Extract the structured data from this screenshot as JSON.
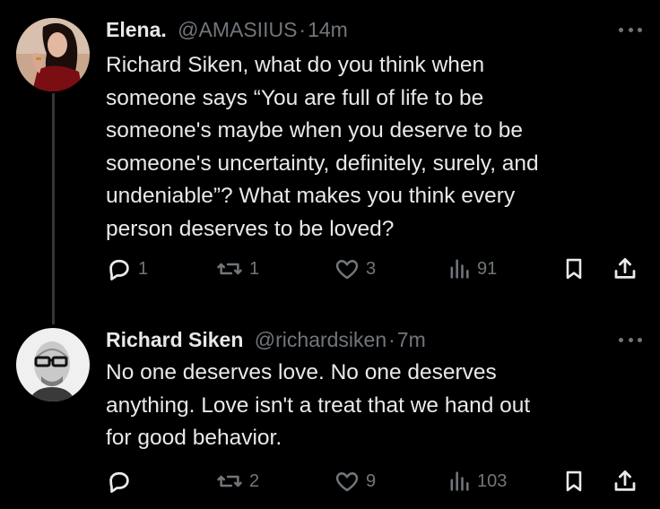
{
  "tweets": [
    {
      "name": "Elena.",
      "handle": "@AMASIIUS",
      "separator": "·",
      "time": "14m",
      "text": "Richard Siken, what do you think when\nsomeone says “You are full of life to be\nsomeone's maybe when you deserve to be\nsomeone's uncertainty, definitely, surely, and\nundeniable”? What makes you think every\nperson deserves to be loved?",
      "replies": "1",
      "reposts": "1",
      "likes": "3",
      "views": "91"
    },
    {
      "name": "Richard Siken",
      "handle": "@richardsiken",
      "separator": "·",
      "time": "7m",
      "text": "No one deserves love. No one deserves\nanything. Love isn't a treat that we hand out\nfor good behavior.",
      "replies": "",
      "reposts": "2",
      "likes": "9",
      "views": "103"
    }
  ],
  "icons": {
    "reply": "reply-icon",
    "repost": "repost-icon",
    "like": "heart-icon",
    "views": "views-icon",
    "bookmark": "bookmark-icon",
    "share": "share-icon",
    "more": "more-icon"
  },
  "colors": {
    "background": "#000000",
    "text": "#e7e9ea",
    "muted": "#71767b",
    "thread_line": "#333639"
  }
}
